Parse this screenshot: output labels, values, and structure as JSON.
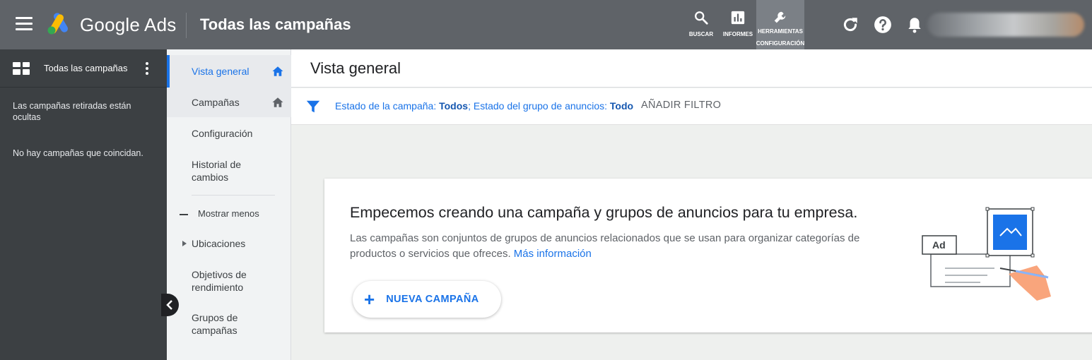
{
  "header": {
    "brand": "Google Ads",
    "page_title": "Todas las campañas",
    "tools": [
      {
        "label": "BUSCAR",
        "icon": "search-icon"
      },
      {
        "label": "INFORMES",
        "icon": "reports-icon"
      },
      {
        "label": "HERRAMIENTAS",
        "label2": "CONFIGURACIÓN",
        "icon": "wrench-icon"
      }
    ],
    "icons": [
      "refresh-icon",
      "help-icon",
      "bell-icon"
    ]
  },
  "left_panel": {
    "title": "Todas las campañas",
    "note": "Las campañas retiradas están ocultas",
    "empty": "No hay campañas que coincidan."
  },
  "nav": {
    "items": [
      {
        "label": "Vista general",
        "active": true
      },
      {
        "label": "Campañas"
      },
      {
        "label": "Configuración"
      },
      {
        "label": "Historial de cambios"
      },
      {
        "label": "Mostrar menos"
      },
      {
        "label": "Ubicaciones"
      },
      {
        "label": "Objetivos de rendimiento"
      },
      {
        "label": "Grupos de campañas"
      }
    ]
  },
  "content": {
    "title": "Vista general",
    "filter": {
      "label1": "Estado de la campaña:",
      "value1": "Todos",
      "sep": ";",
      "label2": " Estado del grupo de anuncios:",
      "value2": "Todo",
      "add_filter": "AÑADIR FILTRO"
    },
    "card": {
      "title": "Empecemos creando una campaña y grupos de anuncios para tu empresa.",
      "description": "Las campañas son conjuntos de grupos de anuncios relacionados que se usan para organizar categorías de productos o servicios que ofreces.",
      "link": "Más información",
      "button": "NUEVA CAMPAÑA",
      "illustration_label": "Ad"
    }
  },
  "colors": {
    "topbar": "#5f6368",
    "left_panel": "#3c4043",
    "accent": "#1a73e8"
  }
}
